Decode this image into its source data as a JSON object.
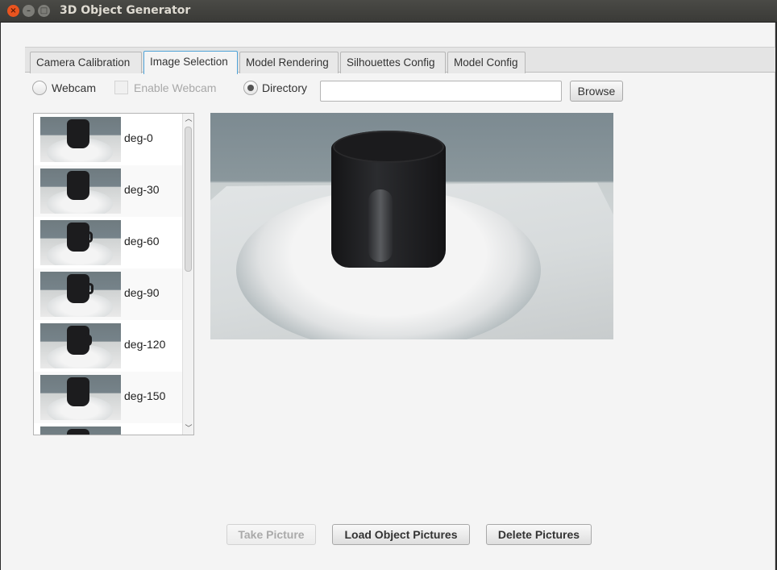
{
  "window": {
    "title": "3D Object Generator",
    "close_glyph": "×",
    "min_glyph": "–",
    "max_glyph": "□"
  },
  "tabs": [
    {
      "label": "Camera Calibration",
      "active": false
    },
    {
      "label": "Image Selection",
      "active": true
    },
    {
      "label": "Model Rendering",
      "active": false
    },
    {
      "label": "Silhouettes Config",
      "active": false
    },
    {
      "label": "Model Config",
      "active": false
    }
  ],
  "source": {
    "webcam_label": "Webcam",
    "enable_webcam_label": "Enable Webcam",
    "directory_label": "Directory",
    "directory_value": "",
    "browse_label": "Browse",
    "selected": "directory"
  },
  "image_list": [
    {
      "label": "deg-0"
    },
    {
      "label": "deg-30"
    },
    {
      "label": "deg-60"
    },
    {
      "label": "deg-90"
    },
    {
      "label": "deg-120"
    },
    {
      "label": "deg-150"
    },
    {
      "label": ""
    }
  ],
  "scrollbar": {
    "up_glyph": "︿",
    "down_glyph": "﹀"
  },
  "actions": {
    "take_picture": "Take Picture",
    "load_pictures": "Load Object Pictures",
    "delete_pictures": "Delete Pictures"
  },
  "colors": {
    "tab_active_border": "#4fa3d8",
    "close_button": "#e9541f",
    "window_bg": "#f4f4f4"
  }
}
